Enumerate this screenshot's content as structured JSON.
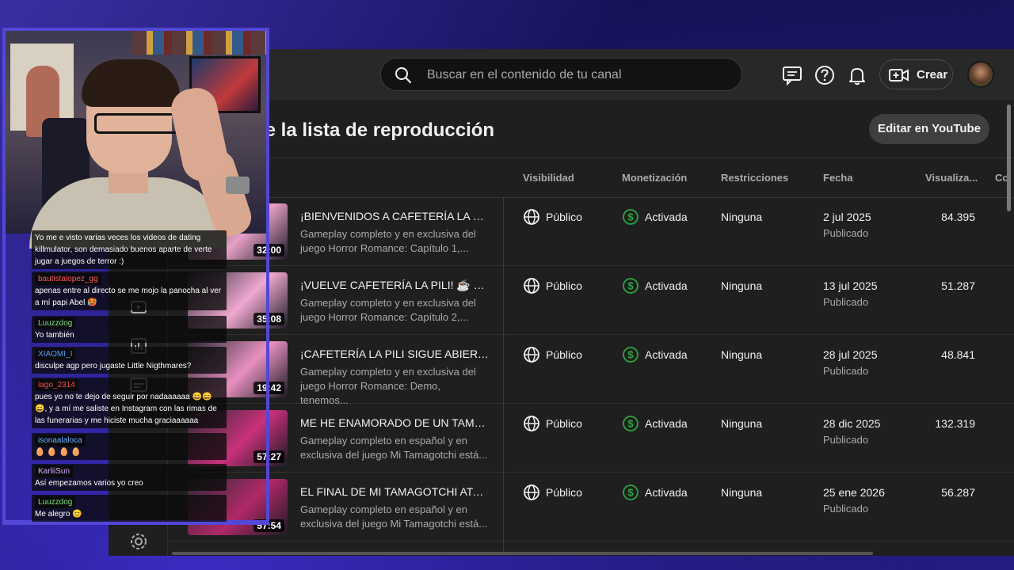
{
  "colors": {
    "accent": "#5347d8",
    "success": "#2ba640",
    "surface": "#1f1f1f",
    "topbar": "#282828"
  },
  "topbar": {
    "search_placeholder": "Buscar en el contenido de tu canal",
    "create_label": "Crear",
    "icons": [
      "feedback-icon",
      "help-icon",
      "bell-icon",
      "create-video-icon"
    ]
  },
  "page": {
    "title": "de la lista de reproducción",
    "edit_button": "Editar en YouTube"
  },
  "table": {
    "columns": {
      "visibility": "Visibilidad",
      "monetization": "Monetización",
      "restrictions": "Restricciones",
      "date": "Fecha",
      "views": "Visualiza...",
      "comments": "Co"
    },
    "rows": [
      {
        "duration": "32:00",
        "title": "¡BIENVENIDOS A CAFETERÍA LA PILI! ...",
        "desc": "Gameplay completo y en exclusiva del juego Horror Romance: Capítulo 1,...",
        "visibility": "Público",
        "monetization": "Activada",
        "restrictions": "Ninguna",
        "date": "2 jul 2025",
        "date_status": "Publicado",
        "views": "84.395",
        "thumb_color": "#e8a0c8"
      },
      {
        "duration": "35:08",
        "title": "¡VUELVE CAFETERÍA LA PILI! ☕ ¿QUI...",
        "desc": "Gameplay completo y en exclusiva del juego Horror Romance: Capítulo 2,...",
        "visibility": "Público",
        "monetization": "Activada",
        "restrictions": "Ninguna",
        "date": "13 jul 2025",
        "date_status": "Publicado",
        "views": "51.287",
        "thumb_color": "#f0a8d0"
      },
      {
        "duration": "19:42",
        "title": "¡CAFETERÍA LA PILI SIGUE ABIERTA! ...",
        "desc": "Gameplay completo y en exclusiva del juego Horror Romance: Demo, tenemos...",
        "visibility": "Público",
        "monetization": "Activada",
        "restrictions": "Ninguna",
        "date": "28 jul 2025",
        "date_status": "Publicado",
        "views": "48.841",
        "thumb_color": "#e890c0"
      },
      {
        "duration": "57:27",
        "title": "ME HE ENAMORADO DE UN TAMAGO...",
        "desc": "Gameplay completo en español y en exclusiva del juego Mi Tamagotchi está...",
        "visibility": "Público",
        "monetization": "Activada",
        "restrictions": "Ninguna",
        "date": "28 dic 2025",
        "date_status": "Publicado",
        "views": "132.319",
        "thumb_color": "#c8307a"
      },
      {
        "duration": "57:54",
        "title": "EL FINAL DE MI TAMAGOTCHI ATAUL...",
        "desc": "Gameplay completo en español y en exclusiva del juego Mi Tamagotchi está...",
        "visibility": "Público",
        "monetization": "Activada",
        "restrictions": "Ninguna",
        "date": "25 ene 2026",
        "date_status": "Publicado",
        "views": "56.287",
        "thumb_color": "#b02868"
      }
    ]
  },
  "chat": {
    "messages": [
      {
        "user": "",
        "user_color": "#ffffff",
        "text": "Yo me e visto varias veces los videos de dating killmulator, son demasiado buenos aparte de verte jugar a juegos de terror :)"
      },
      {
        "user": "bautistalopez_gg",
        "user_color": "#ff5a5a",
        "text": "apenas entre al directo se me mojo la panocha al ver a mí papi Abel 🥵"
      },
      {
        "user": "Luuzzdog",
        "user_color": "#7ee07e",
        "text": "Yo también"
      },
      {
        "user": "XIAOMI_I",
        "user_color": "#5aa0ff",
        "text": "disculpe agp pero jugaste Little Nigthmares?"
      },
      {
        "user": "iago_2314",
        "user_color": "#ff4a4a",
        "text": "pues yo no te dejo de seguir por nadaaaaaa 😄😄😄, y a mí me saliste en Instagram con las rimas de las funerarias y me hiciste mucha graciaaaaaa"
      },
      {
        "user": "isonaalaloca",
        "user_color": "#6ab0ff",
        "text": "🥚 🥚 🥚 🥚"
      },
      {
        "user": "KarliiSun",
        "user_color": "#d8b0ff",
        "text": "Así empezamos varios yo creo"
      },
      {
        "user": "Luuzzdog",
        "user_color": "#7ee07e",
        "text": "Me alegro 😊"
      }
    ]
  }
}
